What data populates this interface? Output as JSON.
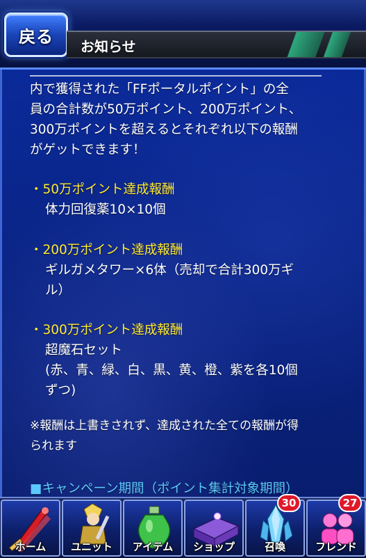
{
  "header": {
    "back_label": "戻る",
    "title": "お知らせ"
  },
  "content": {
    "intro_lines": [
      "内で獲得された「FFポータルポイント」の全",
      "員の合計数が50万ポイント、200万ポイント、",
      "300万ポイントを超えるとそれぞれ以下の報酬",
      "がゲットできます！"
    ],
    "reward_50_title": "・50万ポイント達成報酬",
    "reward_50_detail": "体力回復薬10×10個",
    "reward_200_title": "・200万ポイント達成報酬",
    "reward_200_detail_lines": [
      "ギルガメタワー×6体（売却で合計300万ギ",
      "ル）"
    ],
    "reward_300_title": "・300万ポイント達成報酬",
    "reward_300_detail_lines": [
      "超魔石セット",
      "(赤、青、緑、白、黒、黄、橙、紫を各10個",
      "ずつ)"
    ],
    "note_lines": [
      "※報酬は上書きされず、達成された全ての報酬が得",
      "られます"
    ],
    "campaign_heading": "■キャンペーン期間（ポイント集計対象期間）"
  },
  "nav": {
    "items": [
      {
        "label": "ホーム",
        "icon": "sword-icon"
      },
      {
        "label": "ユニット",
        "icon": "character-icon"
      },
      {
        "label": "アイテム",
        "icon": "potion-icon"
      },
      {
        "label": "ショップ",
        "icon": "shop-chest-icon"
      },
      {
        "label": "召喚",
        "icon": "crystal-icon",
        "badge": "30"
      },
      {
        "label": "フレンド",
        "icon": "friends-icon",
        "badge": "27"
      }
    ]
  },
  "colors": {
    "highlight_yellow": "#ffe936",
    "campaign_blue": "#5cc8ff",
    "badge_red": "#e0192a"
  }
}
